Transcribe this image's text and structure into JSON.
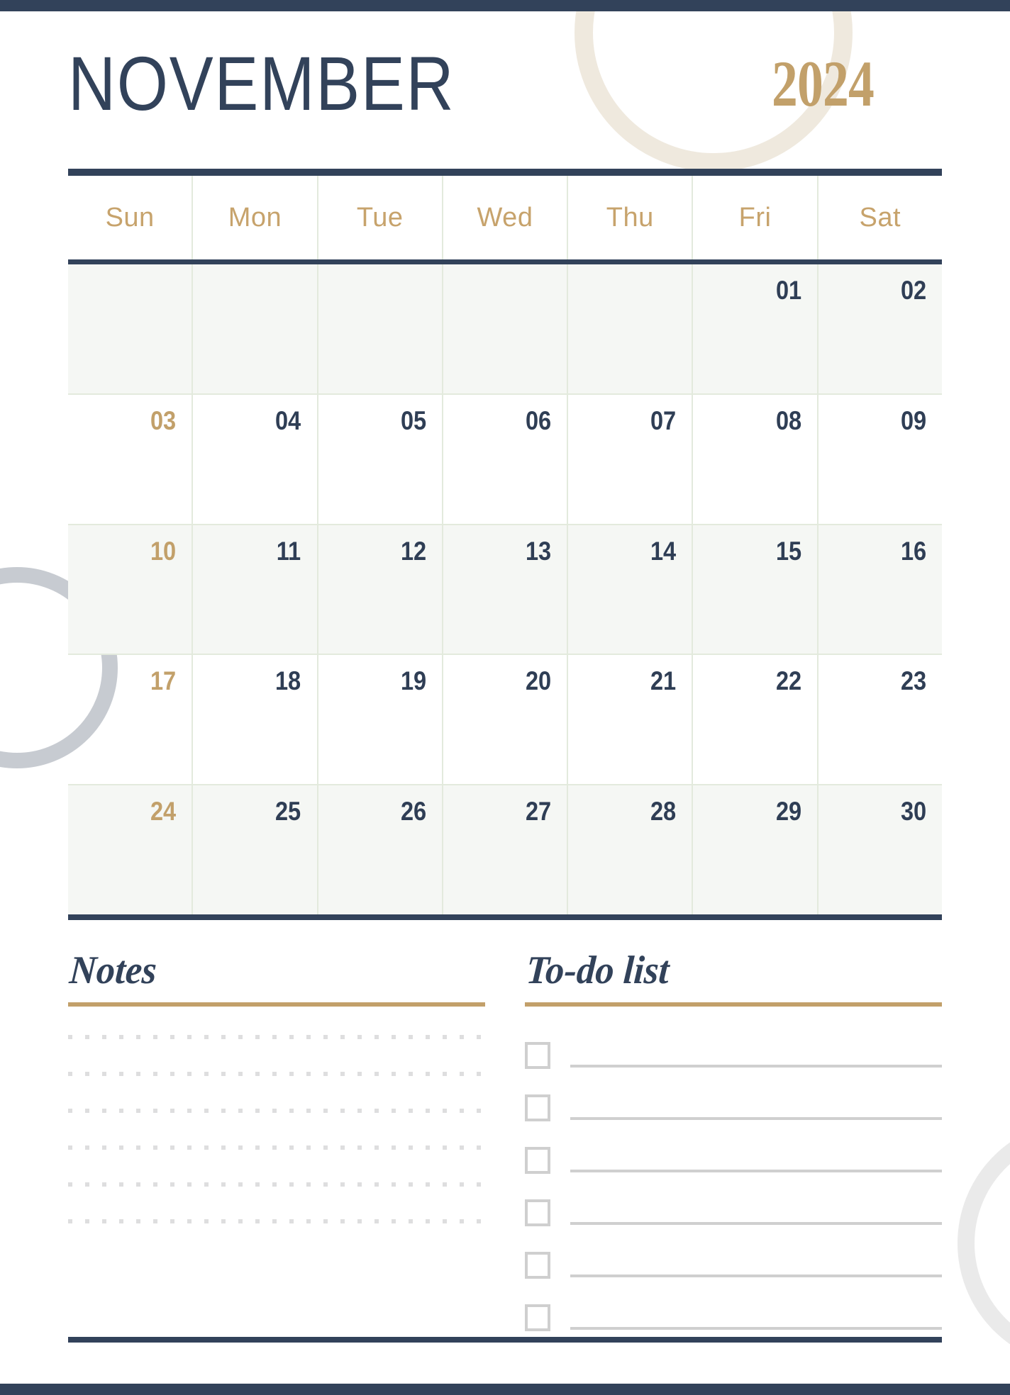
{
  "header": {
    "month": "NOVEMBER",
    "year": "2024"
  },
  "colors": {
    "navy": "#32425a",
    "gold": "#c2a06a",
    "gold_light": "#c7a36c",
    "grid_line": "#e3eadd",
    "row_tint": "#f5f7f4",
    "cream_circle": "#efe9de",
    "gray_circle": "#c7cbd1",
    "light_gray_circle": "#eaeaea",
    "note_dot": "#dededf",
    "todo_gray": "#cfcfcf"
  },
  "weekdays": [
    {
      "label": "Sun"
    },
    {
      "label": "Mon"
    },
    {
      "label": "Tue"
    },
    {
      "label": "Wed"
    },
    {
      "label": "Thu"
    },
    {
      "label": "Fri"
    },
    {
      "label": "Sat"
    }
  ],
  "weeks": [
    {
      "tinted": true,
      "days": [
        {
          "label": "",
          "empty": true,
          "sunday": true
        },
        {
          "label": "",
          "empty": true,
          "sunday": false
        },
        {
          "label": "",
          "empty": true,
          "sunday": false
        },
        {
          "label": "",
          "empty": true,
          "sunday": false
        },
        {
          "label": "",
          "empty": true,
          "sunday": false
        },
        {
          "label": "01",
          "empty": false,
          "sunday": false
        },
        {
          "label": "02",
          "empty": false,
          "sunday": false
        }
      ]
    },
    {
      "tinted": false,
      "days": [
        {
          "label": "03",
          "empty": false,
          "sunday": true
        },
        {
          "label": "04",
          "empty": false,
          "sunday": false
        },
        {
          "label": "05",
          "empty": false,
          "sunday": false
        },
        {
          "label": "06",
          "empty": false,
          "sunday": false
        },
        {
          "label": "07",
          "empty": false,
          "sunday": false
        },
        {
          "label": "08",
          "empty": false,
          "sunday": false
        },
        {
          "label": "09",
          "empty": false,
          "sunday": false
        }
      ]
    },
    {
      "tinted": true,
      "days": [
        {
          "label": "10",
          "empty": false,
          "sunday": true
        },
        {
          "label": "11",
          "empty": false,
          "sunday": false
        },
        {
          "label": "12",
          "empty": false,
          "sunday": false
        },
        {
          "label": "13",
          "empty": false,
          "sunday": false
        },
        {
          "label": "14",
          "empty": false,
          "sunday": false
        },
        {
          "label": "15",
          "empty": false,
          "sunday": false
        },
        {
          "label": "16",
          "empty": false,
          "sunday": false
        }
      ]
    },
    {
      "tinted": false,
      "days": [
        {
          "label": "17",
          "empty": false,
          "sunday": true
        },
        {
          "label": "18",
          "empty": false,
          "sunday": false
        },
        {
          "label": "19",
          "empty": false,
          "sunday": false
        },
        {
          "label": "20",
          "empty": false,
          "sunday": false
        },
        {
          "label": "21",
          "empty": false,
          "sunday": false
        },
        {
          "label": "22",
          "empty": false,
          "sunday": false
        },
        {
          "label": "23",
          "empty": false,
          "sunday": false
        }
      ]
    },
    {
      "tinted": true,
      "days": [
        {
          "label": "24",
          "empty": false,
          "sunday": true
        },
        {
          "label": "25",
          "empty": false,
          "sunday": false
        },
        {
          "label": "26",
          "empty": false,
          "sunday": false
        },
        {
          "label": "27",
          "empty": false,
          "sunday": false
        },
        {
          "label": "28",
          "empty": false,
          "sunday": false
        },
        {
          "label": "29",
          "empty": false,
          "sunday": false
        },
        {
          "label": "30",
          "empty": false,
          "sunday": false
        }
      ]
    }
  ],
  "notes": {
    "title": "Notes",
    "line_count": 6,
    "lines": [
      "",
      "",
      "",
      "",
      "",
      ""
    ]
  },
  "todo": {
    "title": "To-do list",
    "item_count": 6,
    "items": [
      {
        "text": "",
        "checked": false
      },
      {
        "text": "",
        "checked": false
      },
      {
        "text": "",
        "checked": false
      },
      {
        "text": "",
        "checked": false
      },
      {
        "text": "",
        "checked": false
      },
      {
        "text": "",
        "checked": false
      }
    ]
  }
}
